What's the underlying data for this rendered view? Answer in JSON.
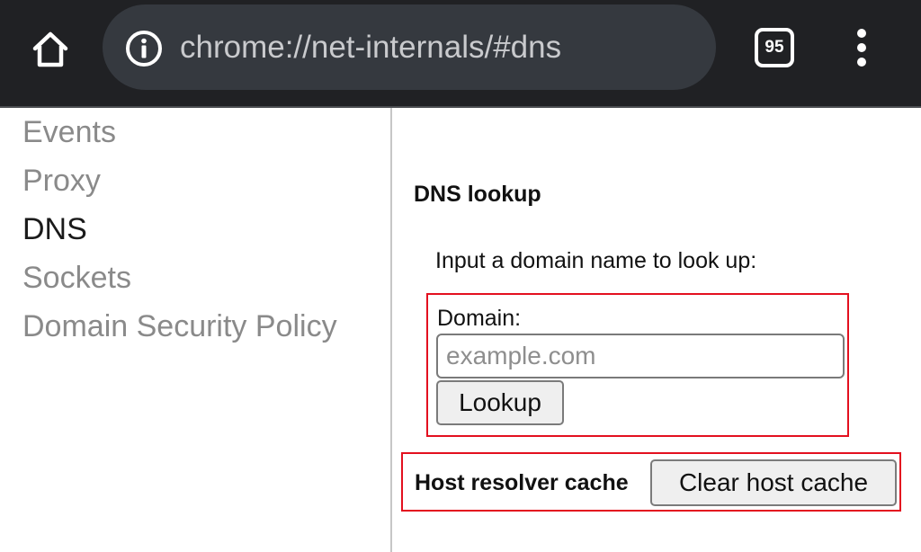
{
  "browser": {
    "url": "chrome://net-internals/#dns",
    "tab_count": "95",
    "icons": {
      "home": "home-icon",
      "site_info": "info-icon",
      "tabs": "tab-switcher-icon",
      "menu": "more-vert-icon"
    }
  },
  "sidebar": {
    "items": [
      {
        "label": "Events",
        "active": false
      },
      {
        "label": "Proxy",
        "active": false
      },
      {
        "label": "DNS",
        "active": true
      },
      {
        "label": "Sockets",
        "active": false
      },
      {
        "label": "Domain Security Policy",
        "active": false
      }
    ]
  },
  "main": {
    "section_title": "DNS lookup",
    "instruction": "Input a domain name to look up:",
    "domain_label": "Domain:",
    "domain_value": "",
    "domain_placeholder": "example.com",
    "lookup_label": "Lookup",
    "cache_label": "Host resolver cache",
    "clear_cache_label": "Clear host cache"
  },
  "colors": {
    "toolbar_bg": "#202124",
    "omnibox_bg": "#35393f",
    "highlight_border": "#e3101f",
    "inactive_nav": "#8a8a8a",
    "active_nav": "#1a1a1a"
  }
}
